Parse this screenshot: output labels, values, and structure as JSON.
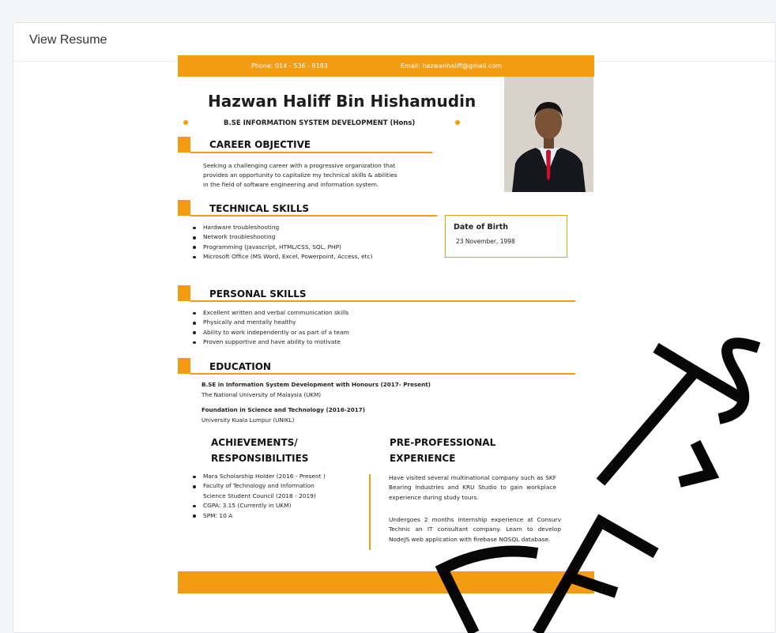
{
  "card": {
    "title": "View Resume"
  },
  "resume": {
    "phone": "Phone: 014 - 536 - 8183",
    "email": "Email: hazwanhaliff@gmail.com",
    "name": "Hazwan Haliff Bin Hishamudin",
    "degree": "B.SE INFORMATION SYSTEM DEVELOPMENT (Hons)",
    "career_objective": {
      "title": "CAREER OBJECTIVE",
      "lines": [
        "Seeking a challenging career with a progressive organization that",
        "provides an opportunity to capitalize my technical skills & abilities",
        "in the field of software engineering and information system."
      ]
    },
    "technical_skills": {
      "title": "TECHNICAL SKILLS",
      "items": [
        "Hardware troubleshooting",
        "Network troubleshooting",
        "Programming (Javascript, HTML/CSS, SQL, PHP)",
        "Microsoft Office (MS Word, Excel, Powerpoint, Access, etc)"
      ]
    },
    "dob": {
      "label": "Date of Birth",
      "value": "23 November, 1998"
    },
    "personal_skills": {
      "title": "PERSONAL SKILLS",
      "items": [
        "Excellent written and verbal communication skills",
        "Physically and mentally healthy",
        "Ability to work independently or as part of a team",
        "Proven supportive and have ability to motivate"
      ]
    },
    "education": {
      "title": "EDUCATION",
      "entries": [
        {
          "degree": "B.SE in Information System Development with Honours (2017- Present)",
          "school": "The National University of Malaysia (UKM)"
        },
        {
          "degree": "Foundation in Science and Technology (2016-2017)",
          "school": "University Kuala Lumpur (UNIKL)"
        }
      ]
    },
    "achievements": {
      "title_line1": "ACHIEVEMENTS/",
      "title_line2": "RESPONSIBILITIES",
      "items": [
        {
          "line1": "Mara Scholarship Holder (2016 - Present )"
        },
        {
          "line1": "Faculty of Technology and Information",
          "line2": "Science Student Council (2018 - 2019)"
        },
        {
          "line1": "CGPA: 3.15 (Currently in UKM)"
        },
        {
          "line1": "SPM: 10 A"
        }
      ]
    },
    "experience": {
      "title_line1": "PRE-PROFESSIONAL",
      "title_line2": "EXPERIENCE",
      "para1": "Have visited several multinational company such as SKF Bearing Industries and KRU Studio to gain workplace experience during study tours.",
      "para2": "Undergoes 2 months internship experience at Consurv Technic an IT consultant company. Learn to develop NodeJS web application with firebase NOSQL database."
    }
  },
  "colors": {
    "accent": "#f39c12"
  }
}
